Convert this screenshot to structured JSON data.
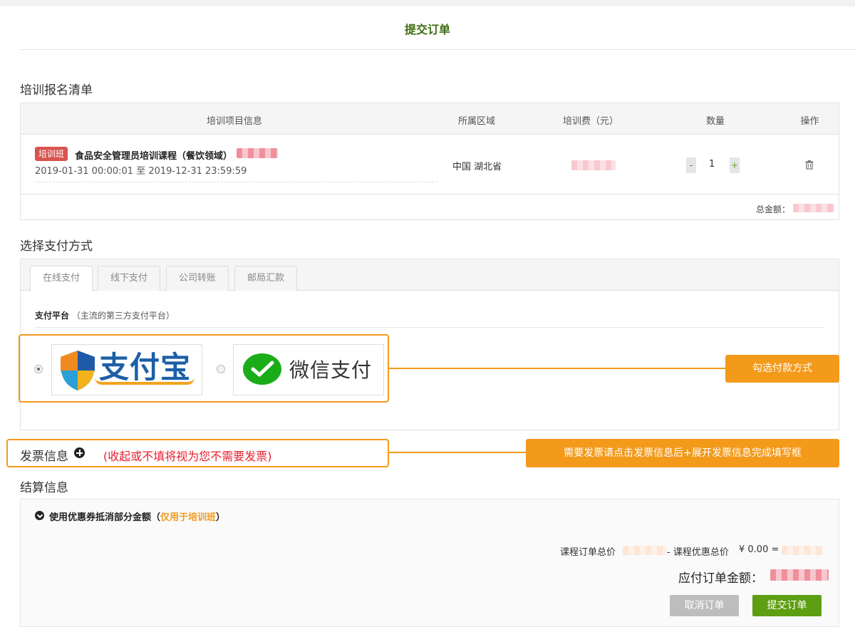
{
  "page": {
    "title": "提交订单"
  },
  "order": {
    "section_title": "培训报名清单",
    "columns": [
      "培训项目信息",
      "所属区域",
      "培训费（元）",
      "数量",
      "操作"
    ],
    "item": {
      "tag": "培训班",
      "name": "食品安全管理员培训课程（餐饮领域）",
      "dates": "2019-01-31 00:00:01 至 2019-12-31 23:59:59",
      "region": "中国 湖北省",
      "qty_minus": "-",
      "quantity": "1",
      "qty_plus": "+"
    },
    "total_label": "总金额："
  },
  "payment": {
    "section_title": "选择支付方式",
    "tabs": [
      "在线支付",
      "线下支付",
      "公司转账",
      "邮局汇款"
    ],
    "platform_label": "支付平台",
    "platform_hint": "（主流的第三方支付平台）",
    "alipay_text": "支付宝",
    "wechat_text": "微信支付",
    "callout": "勾选付款方式"
  },
  "invoice": {
    "title": "发票信息",
    "note": "(收起或不填将视为您不需要发票)",
    "callout": "需要发票请点击发票信息后+展开发票信息完成填写框"
  },
  "settlement": {
    "section_title": "结算信息",
    "coupon_label": "使用优惠券抵消部分金额（",
    "coupon_only": "仅用于培训班",
    "coupon_close": "）",
    "course_total_label": "课程订单总价",
    "discount_label": "- 课程优惠总价",
    "discount_value": "¥ 0.00 =",
    "payable_label": "应付订单金额：",
    "cancel_button": "取消订单",
    "submit_button": "提交订单"
  },
  "colors": {
    "accent_green": "#6aa51f",
    "highlight_orange": "#f39a1b",
    "tag_red": "#d9534f",
    "note_red": "#e8202e"
  }
}
